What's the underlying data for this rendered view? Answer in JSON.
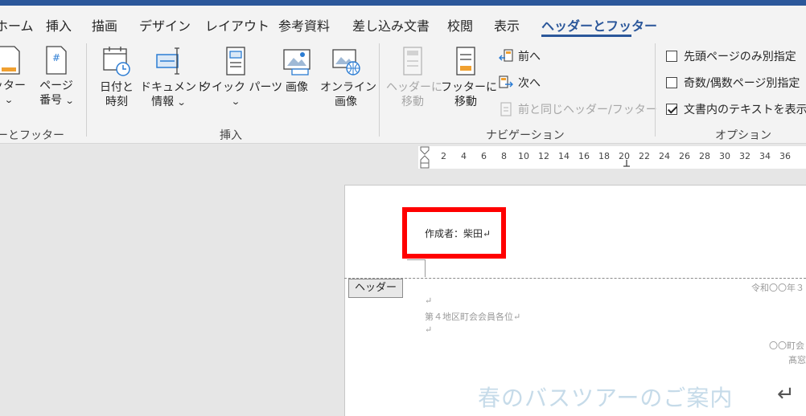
{
  "tabs": [
    {
      "label": "ホーム",
      "active": false
    },
    {
      "label": "挿入",
      "active": false
    },
    {
      "label": "描画",
      "active": false
    },
    {
      "label": "デザイン",
      "active": false
    },
    {
      "label": "レイアウト",
      "active": false
    },
    {
      "label": "参考資料",
      "active": false
    },
    {
      "label": "差し込み文書",
      "active": false
    },
    {
      "label": "校閲",
      "active": false
    },
    {
      "label": "表示",
      "active": false
    },
    {
      "label": "ヘッダーとフッター",
      "active": true
    }
  ],
  "ribbon": {
    "group1": {
      "label": "ーとフッター",
      "footer_btn": "ッター",
      "page_number_btn_line1": "ページ",
      "page_number_btn_line2": "番号"
    },
    "insert": {
      "label": "挿入",
      "date_time_line1": "日付と",
      "date_time_line2": "時刻",
      "doc_info_line1": "ドキュメント",
      "doc_info_line2": "情報",
      "quick_parts": "クイック パーツ",
      "picture": "画像",
      "online_picture_line1": "オンライン",
      "online_picture_line2": "画像"
    },
    "navigation": {
      "label": "ナビゲーション",
      "goto_header_line1": "ヘッダーに",
      "goto_header_line2": "移動",
      "goto_footer_line1": "フッターに",
      "goto_footer_line2": "移動",
      "previous": "前へ",
      "next": "次へ",
      "link_previous": "前と同じヘッダー/フッター"
    },
    "options": {
      "label": "オプション",
      "different_first_page": "先頭ページのみ別指定",
      "different_odd_even": "奇数/偶数ページ別指定",
      "show_document_text": "文書内のテキストを表示",
      "different_first_page_checked": false,
      "different_odd_even_checked": false,
      "show_document_text_checked": true
    }
  },
  "ruler": {
    "ticks": [
      "2",
      "4",
      "6",
      "8",
      "10",
      "12",
      "14",
      "16",
      "18",
      "20",
      "22",
      "24",
      "26",
      "28",
      "30",
      "32",
      "34",
      "36"
    ]
  },
  "document": {
    "header_text": "作成者：柴田↵",
    "header_tag": "ヘッダー",
    "date_line": "令和〇〇年３",
    "para_mark": "↵",
    "addressee": "第４地区町会会員各位↵",
    "org_line1": "〇〇町会",
    "org_line2": "髙窓",
    "title": "春のバスツアーのご案内",
    "title_return": "↵"
  },
  "colors": {
    "accent": "#2b579a",
    "highlight": "#ff0000"
  }
}
